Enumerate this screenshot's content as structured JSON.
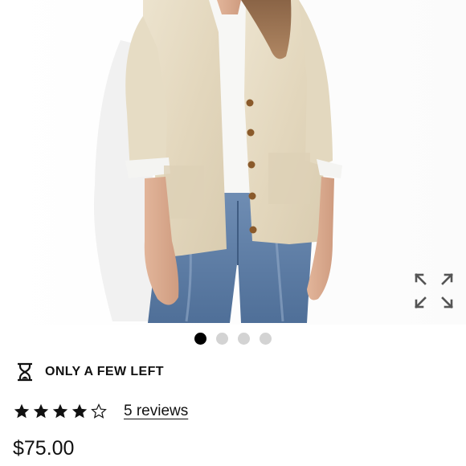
{
  "gallery": {
    "image_alt": "Cardigan sweater product photo",
    "slide_count": 4,
    "active_slide": 1,
    "expand_icon": "expand-arrows-icon"
  },
  "stock": {
    "icon": "hourglass-icon",
    "text": "ONLY A FEW LEFT"
  },
  "rating": {
    "value": 4,
    "max": 5,
    "reviews_label": "5 reviews"
  },
  "price": "$75.00",
  "colors": {
    "text": "#111111",
    "dot_active": "#000000",
    "dot_inactive": "#d3d3d3"
  }
}
